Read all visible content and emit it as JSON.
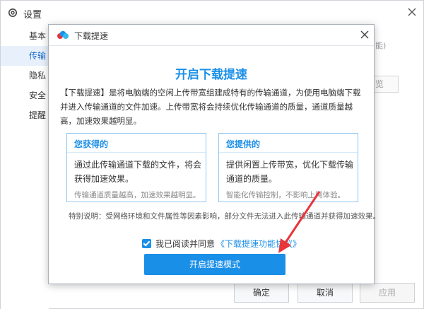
{
  "settings": {
    "title": "设置",
    "sidebar": [
      {
        "label": "基本",
        "active": false
      },
      {
        "label": "传输",
        "active": true
      },
      {
        "label": "隐私",
        "active": false
      },
      {
        "label": "安全",
        "active": false
      },
      {
        "label": "提醒",
        "active": false
      }
    ],
    "partial_text": "能)",
    "partial_button": "览",
    "footer": {
      "ok_label": "确定",
      "cancel_label": "取消",
      "apply_label": "应用"
    }
  },
  "dialog": {
    "title": "下载提速",
    "heading": "开启下载提速",
    "description": "【下载提速】是将电脑端的空闲上传带宽组建成特有的传输通道，为使用电脑端下载并进入传输通道的文件加速。上传带宽将会持续优化传输通道的质量，通道质量越高，加速效果越明显。",
    "left_box": {
      "title": "您获得的",
      "body": "通过此传输通道下载的文件，将会获得加速效果。",
      "note": "传输通道质量越高，加速效果越明显。"
    },
    "right_box": {
      "title": "您提供的",
      "body": "提供闲置上传带宽，优化下载传输通道的质量。",
      "note": "智能化传输控制，不影响上网体验。"
    },
    "special_note": "特别说明：受网络环境和文件属性等因素影响，部分文件无法进入此传输通道并获得加速效果。",
    "agree_text": "我已阅读并同意",
    "agree_link": "《下载提速功能协议》",
    "agree_checked": true,
    "primary_button": "开启提速模式"
  },
  "colors": {
    "accent": "#1a8fe8",
    "arrow": "#e8363a"
  }
}
